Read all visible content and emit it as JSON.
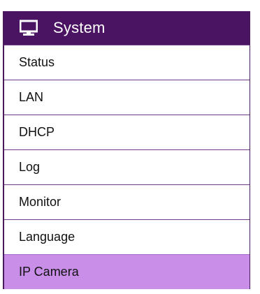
{
  "menu": {
    "header": {
      "icon": "monitor-icon",
      "title": "System"
    },
    "items": [
      {
        "label": "Status",
        "selected": false
      },
      {
        "label": "LAN",
        "selected": false
      },
      {
        "label": "DHCP",
        "selected": false
      },
      {
        "label": "Log",
        "selected": false
      },
      {
        "label": "Monitor",
        "selected": false
      },
      {
        "label": "Language",
        "selected": false
      },
      {
        "label": "IP Camera",
        "selected": true
      }
    ],
    "colors": {
      "header_bg": "#4b1463",
      "selected_bg": "#c98ee8",
      "border": "#6e3a86"
    }
  }
}
